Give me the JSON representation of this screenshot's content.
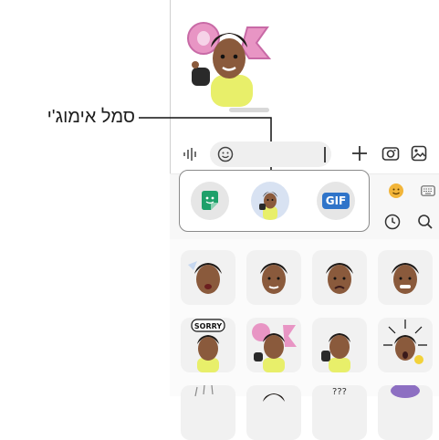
{
  "callout": {
    "label": "סמל אימוג'י"
  },
  "composer": {
    "gif_label": "GIF"
  },
  "colors": {
    "accent_blue": "#2f74c9",
    "sticker_app_green": "#1ea06a",
    "skin": "#8a5a3c",
    "hair": "#1f1a17",
    "shirt_yellow": "#e8ef6a",
    "pink_letters": "#e895c4"
  },
  "grid": {
    "top_row_text": "SORRY",
    "bottom_row_text": "???"
  }
}
